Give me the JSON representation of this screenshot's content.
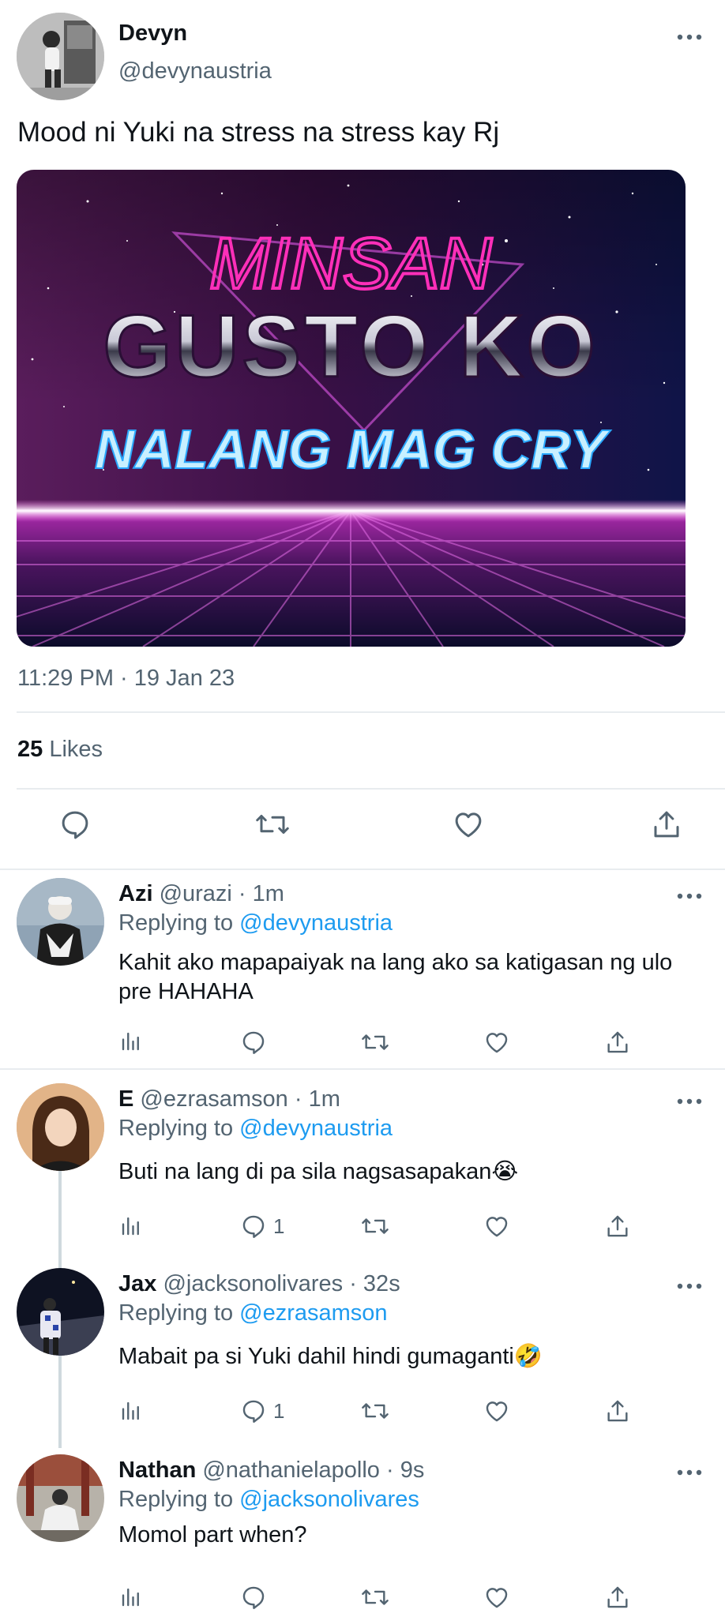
{
  "tweet": {
    "author_name": "Devyn",
    "author_handle": "@devynaustria",
    "text": "Mood ni Yuki na stress na stress kay Rj",
    "image_text": {
      "line1": "MINSAN",
      "line2": "GUSTO KO",
      "line3": "NALANG MAG CRY"
    },
    "timestamp": "11:29 PM · 19 Jan 23",
    "likes_count": "25",
    "likes_label": "Likes",
    "actions": [
      "reply-icon",
      "retweet-icon",
      "like-icon",
      "share-icon"
    ]
  },
  "replies": [
    {
      "name": "Azi",
      "handle": "@urazi",
      "time": "· 1m",
      "replying_label": "Replying to",
      "replying_to": "@devynaustria",
      "text": "Kahit ako mapapaiyak na lang ako sa katigasan ng ulo pre HAHAHA",
      "reply_count": ""
    },
    {
      "name": "E",
      "handle": "@ezrasamson",
      "time": "· 1m",
      "replying_label": "Replying to",
      "replying_to": "@devynaustria",
      "text": "Buti na lang di pa sila nagsasapakan😭",
      "reply_count": "1"
    },
    {
      "name": "Jax",
      "handle": "@jacksonolivares",
      "time": "· 32s",
      "replying_label": "Replying to",
      "replying_to": "@ezrasamson",
      "text": "Mabait pa si Yuki dahil hindi gumaganti🤣",
      "reply_count": "1"
    },
    {
      "name": "Nathan",
      "handle": "@nathanielapollo",
      "time": "· 9s",
      "replying_label": "Replying to",
      "replying_to": "@jacksonolivares",
      "text": "Momol part when?",
      "reply_count": ""
    }
  ],
  "colors": {
    "link": "#1d9bf0",
    "secondary": "#536471",
    "divider": "#e8ecef",
    "neon_pink": "#ff2fb9"
  }
}
